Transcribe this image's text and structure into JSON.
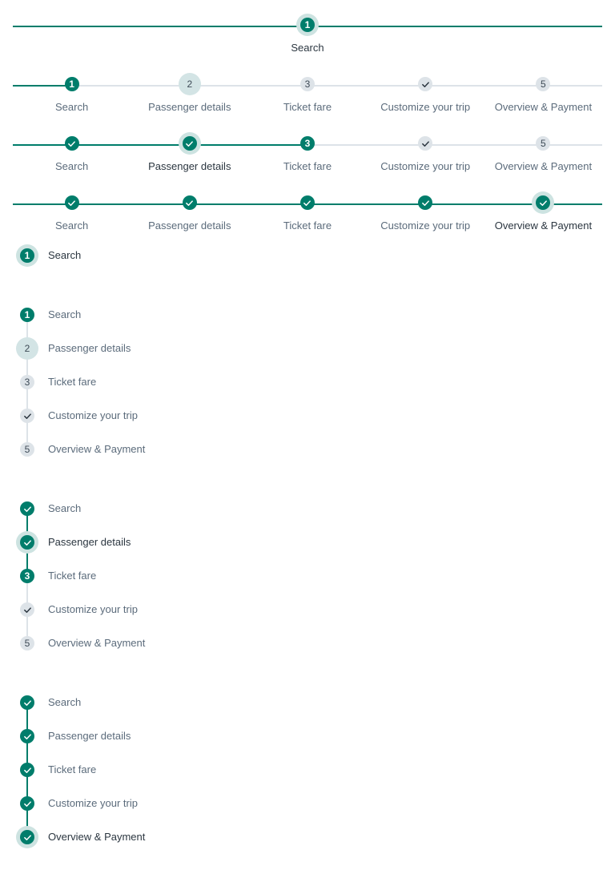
{
  "colors": {
    "accent": "#007d6b",
    "inactive": "#dde3e8",
    "halo": "#cde3e1",
    "text": "#5b6b7b",
    "text_active": "#2b3640"
  },
  "labels": {
    "search": "Search",
    "passenger": "Passenger details",
    "fare": "Ticket fare",
    "customize": "Customize your trip",
    "overview": "Overview & Payment"
  },
  "numbers": {
    "one": "1",
    "two": "2",
    "three": "3",
    "five": "5"
  },
  "icons": {
    "check": "check-icon"
  }
}
